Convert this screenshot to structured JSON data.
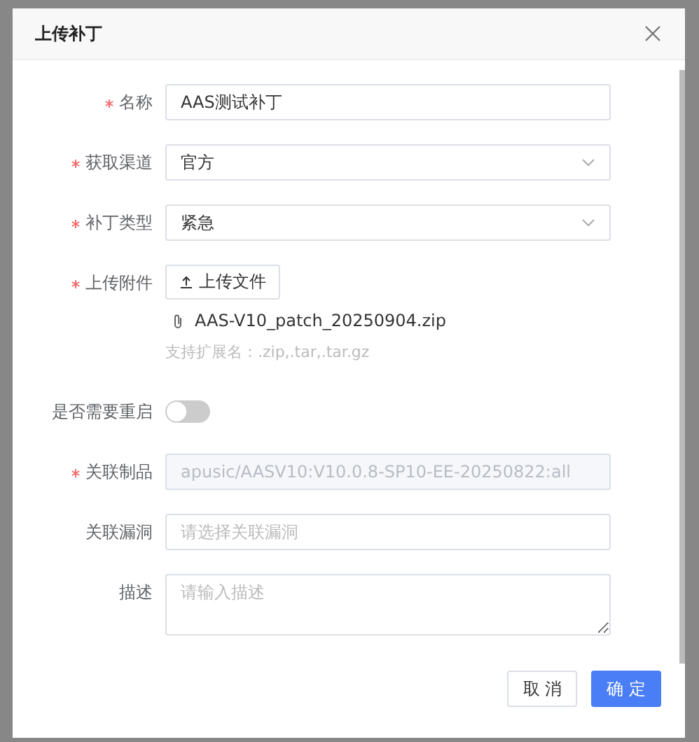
{
  "dialog": {
    "title": "上传补丁"
  },
  "fields": [
    {
      "kind": "text",
      "label": "名称",
      "required": true,
      "value": "AAS测试补丁"
    },
    {
      "kind": "select",
      "label": "获取渠道",
      "required": true,
      "value": "官方"
    },
    {
      "kind": "select",
      "label": "补丁类型",
      "required": true,
      "value": "紧急"
    },
    {
      "kind": "upload",
      "label": "上传附件",
      "required": true,
      "button": "上传文件",
      "file": "AAS-V10_patch_20250904.zip",
      "hint": "支持扩展名：.zip,.tar,.tar.gz"
    },
    {
      "kind": "switch",
      "label": "是否需要重启",
      "required": false,
      "on": false
    },
    {
      "kind": "text",
      "label": "关联制品",
      "required": true,
      "value": "apusic/AASV10:V10.0.8-SP10-EE-20250822:all",
      "disabled": true
    },
    {
      "kind": "text",
      "label": "关联漏洞",
      "required": false,
      "placeholder": "请选择关联漏洞"
    },
    {
      "kind": "textarea",
      "label": "描述",
      "required": false,
      "placeholder": "请输入描述"
    }
  ],
  "buttons": [
    {
      "label": "取 消",
      "primary": false
    },
    {
      "label": "确 定",
      "primary": true
    }
  ]
}
